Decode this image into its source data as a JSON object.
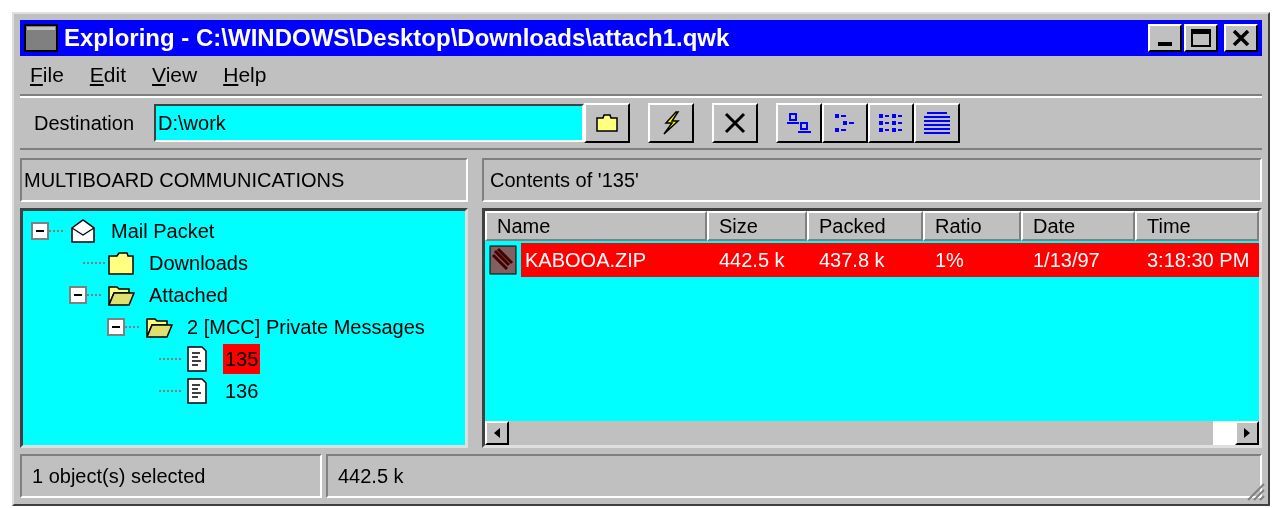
{
  "window": {
    "title": "Exploring - C:\\WINDOWS\\Desktop\\Downloads\\attach1.qwk"
  },
  "menu": [
    "File",
    "Edit",
    "View",
    "Help"
  ],
  "toolbar": {
    "destination_label": "Destination",
    "destination_value": "D:\\work"
  },
  "tree_pane": {
    "header": "MULTIBOARD COMMUNICATIONS",
    "items": [
      {
        "label": "Mail Packet",
        "kind": "envelope",
        "expanded": true,
        "selected": false,
        "children": [
          {
            "label": "Downloads",
            "kind": "folder",
            "selected": false
          },
          {
            "label": "Attached",
            "kind": "open-folder",
            "expanded": true,
            "selected": false,
            "children": [
              {
                "label": "2 [MCC] Private Messages",
                "kind": "open-folder",
                "expanded": true,
                "selected": false,
                "children": [
                  {
                    "label": "135",
                    "kind": "message",
                    "selected": true
                  },
                  {
                    "label": "136",
                    "kind": "message",
                    "selected": false
                  }
                ]
              }
            ]
          }
        ]
      }
    ]
  },
  "list_pane": {
    "header": "Contents of '135'",
    "columns": [
      "Name",
      "Size",
      "Packed",
      "Ratio",
      "Date",
      "Time"
    ],
    "rows": [
      {
        "cells": [
          "KABOOA.ZIP",
          "442.5 k",
          "437.8 k",
          "1%",
          "1/13/97",
          "3:18:30 PM"
        ],
        "selected": true
      }
    ]
  },
  "status_bar": [
    "1 object(s) selected",
    "442.5 k"
  ]
}
